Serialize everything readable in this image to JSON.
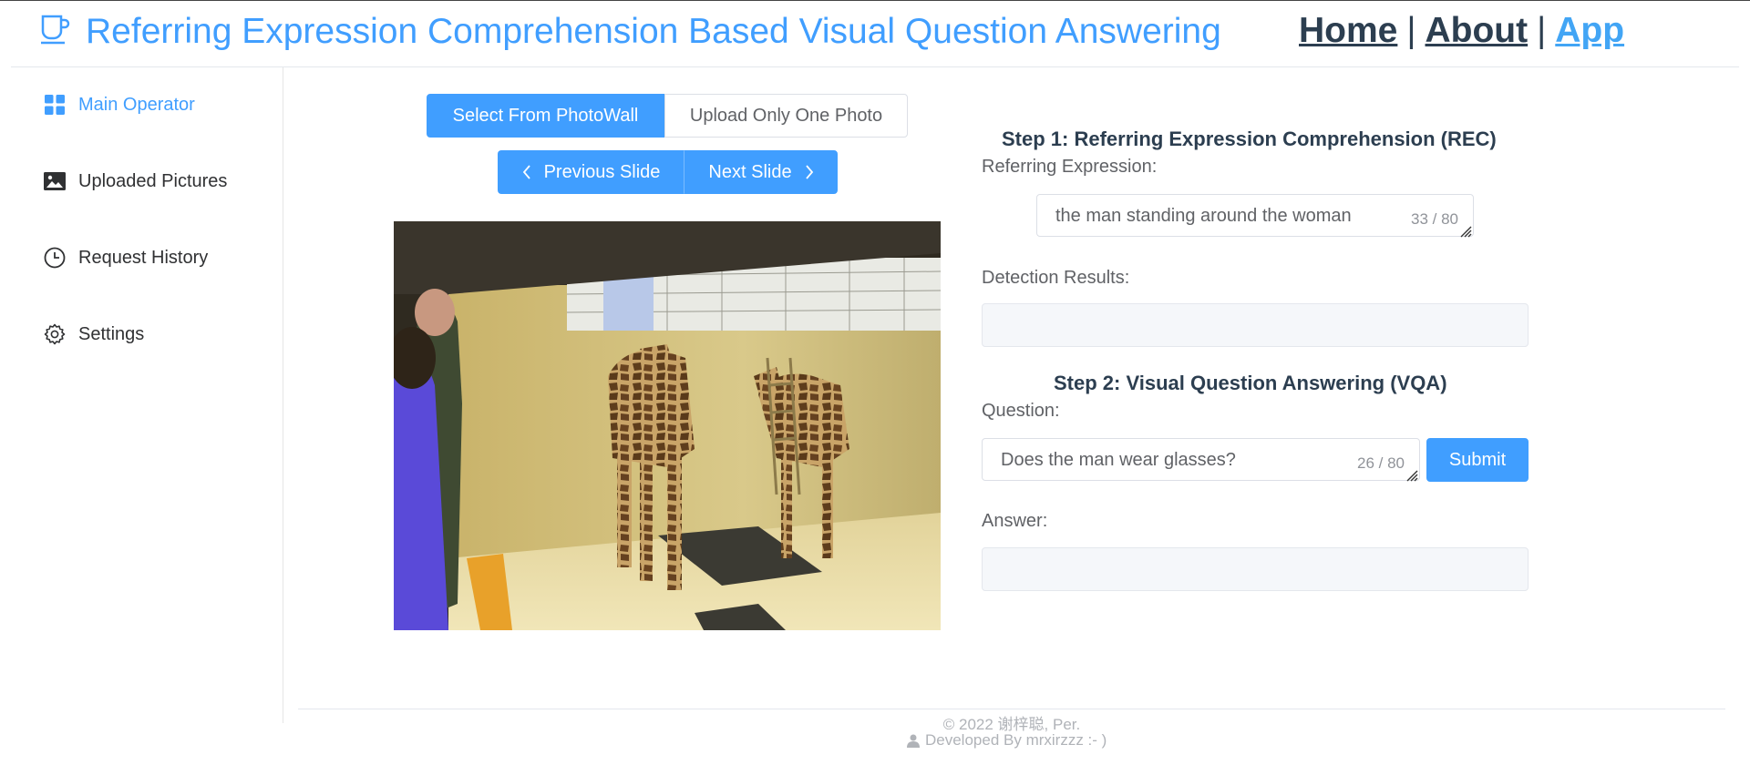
{
  "header": {
    "title": "Referring Expression Comprehension Based Visual Question Answering",
    "nav": {
      "home": "Home",
      "about": "About",
      "app": "App",
      "separator": "|"
    },
    "logo_icon": "coffee-cup-icon",
    "accent_color": "#409eff"
  },
  "sidebar": {
    "items": [
      {
        "label": "Main Operator",
        "icon": "grid-icon",
        "active": true
      },
      {
        "label": "Uploaded Pictures",
        "icon": "picture-icon",
        "active": false
      },
      {
        "label": "Request History",
        "icon": "clock-icon",
        "active": false
      },
      {
        "label": "Settings",
        "icon": "gear-icon",
        "active": false
      }
    ]
  },
  "main": {
    "source_buttons": {
      "photowall": "Select From PhotoWall",
      "upload": "Upload Only One Photo"
    },
    "slide_buttons": {
      "previous": "Previous Slide",
      "next": "Next Slide"
    }
  },
  "step1": {
    "title": "Step 1: Referring Expression Comprehension (REC)",
    "expression_label": "Referring Expression:",
    "expression_value": "the man standing around the woman",
    "expression_count": "33 / 80",
    "detection_label": "Detection Results:"
  },
  "step2": {
    "title": "Step 2: Visual Question Answering (VQA)",
    "question_label": "Question:",
    "question_value": "Does the man wear glasses?",
    "question_count": "26 / 80",
    "submit_label": "Submit",
    "answer_label": "Answer:"
  },
  "footer": {
    "copyright": "© 2022 谢梓聪, Per.",
    "developer": "Developed By mrxirzzz :- )"
  }
}
